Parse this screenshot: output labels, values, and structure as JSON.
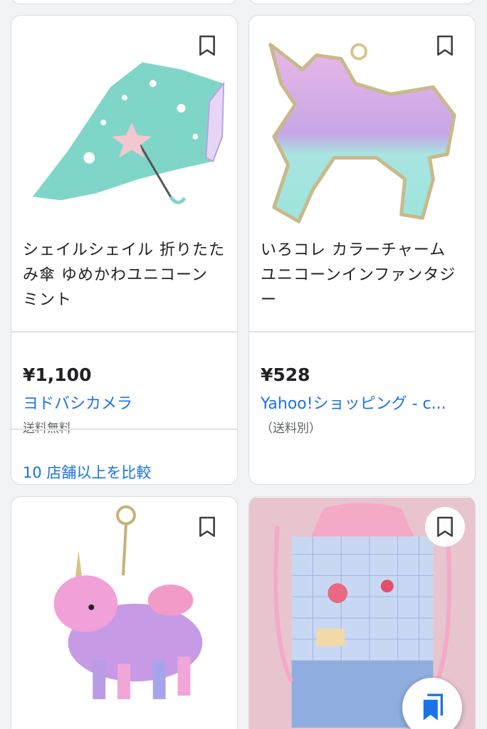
{
  "products": [
    {
      "title": "シェイルシェイル 折りたたみ傘 ゆめかわユニコーン ミント",
      "price": "¥1,100",
      "store": "ヨドバシカメラ",
      "shipping": "送料無料",
      "compare": "10 店舗以上を比較"
    },
    {
      "title": "いろコレ カラーチャーム ユニコーンインファンタジー",
      "price": "¥528",
      "store": "Yahoo!ショッピング - c...",
      "shipping": "（送料別）"
    }
  ],
  "icons": {
    "bookmark": "bookmark-outline-icon",
    "fab": "bookmark-filled-icon"
  },
  "colors": {
    "link": "#1a73e8",
    "fab_icon": "#1a73e8"
  }
}
